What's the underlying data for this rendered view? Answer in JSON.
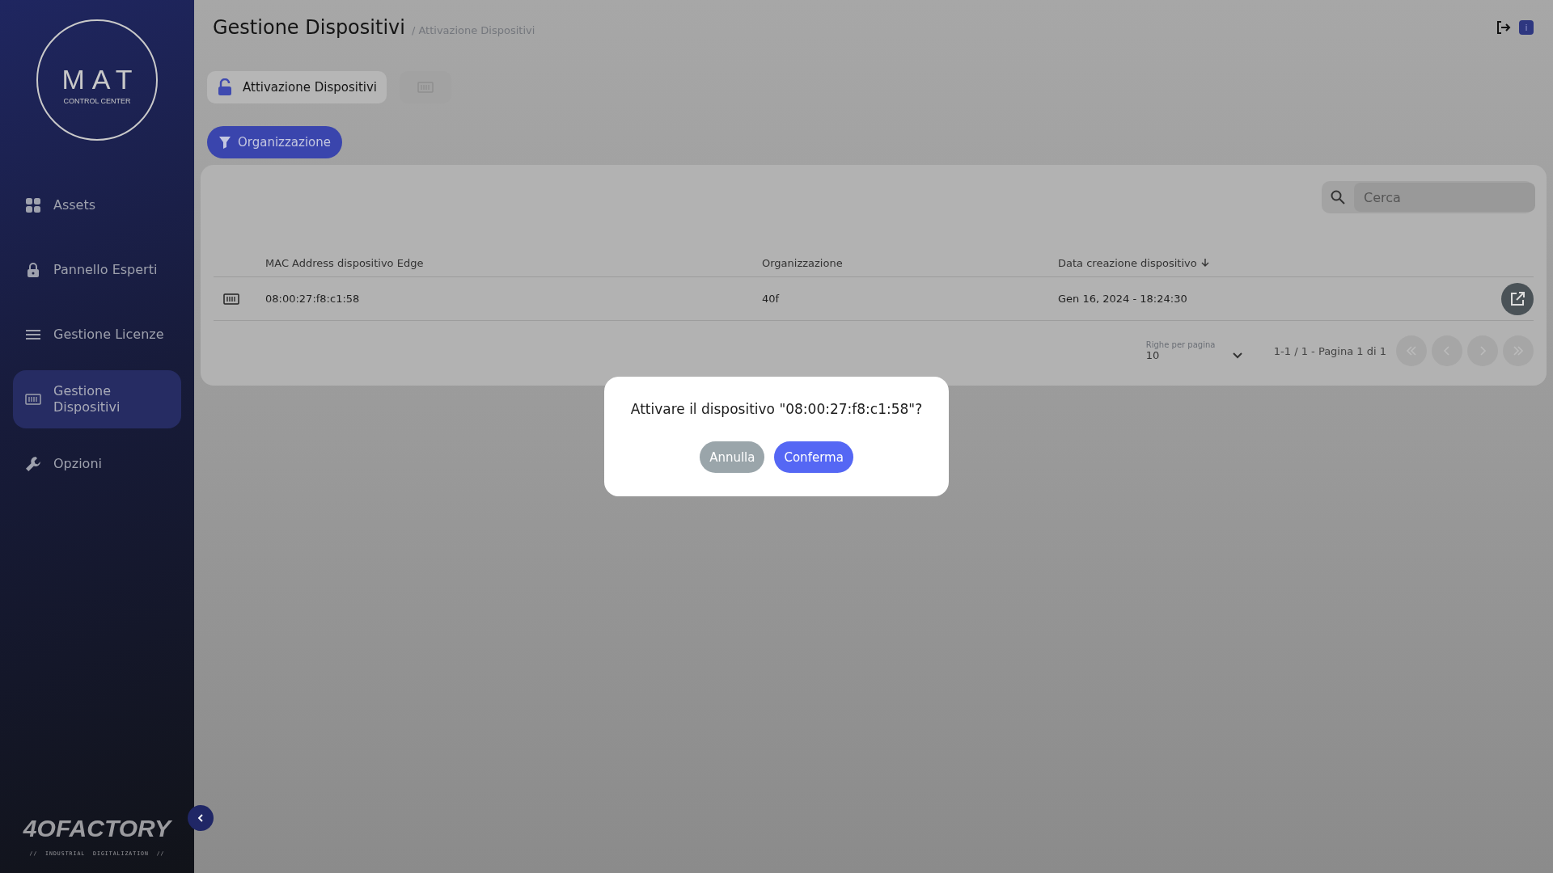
{
  "sidebar": {
    "logo": {
      "title": "MAT",
      "subtitle": "CONTROL CENTER"
    },
    "items": [
      {
        "label": "Assets",
        "selected": false
      },
      {
        "label": "Pannello Esperti",
        "selected": false
      },
      {
        "label": "Gestione Licenze",
        "selected": false
      },
      {
        "label": "Gestione Dispositivi",
        "selected": true
      },
      {
        "label": "Opzioni",
        "selected": false
      }
    ],
    "brand": {
      "name": "4OFACTORY",
      "tagline": "//  INDUSTRIAL  DIGITALIZATION  //"
    }
  },
  "header": {
    "title": "Gestione Dispositivi",
    "breadcrumb": "/ Attivazione Dispositivi",
    "info_badge": "i"
  },
  "tabs": [
    {
      "label": "Attivazione Dispositivi",
      "selected": true
    },
    {
      "selected": false
    }
  ],
  "filter_button": "Organizzazione",
  "search": {
    "placeholder": "Cerca"
  },
  "table": {
    "columns": [
      "MAC Address dispositivo Edge",
      "Organizzazione",
      "Data creazione dispositivo"
    ],
    "rows": [
      {
        "cells": [
          "08:00:27:f8:c1:58",
          "40f",
          "Gen 16, 2024 - 18:24:30"
        ]
      }
    ]
  },
  "pagination": {
    "rows_label": "Righe per pagina",
    "rows_value": "10",
    "range": "1-1 / 1 - Pagina 1 di 1",
    "buttons": [
      {
        "disabled": true
      },
      {
        "disabled": true
      },
      {
        "disabled": true
      },
      {
        "disabled": true
      }
    ]
  },
  "dialog": {
    "message": "Attivare il dispositivo \"08:00:27:f8:c1:58\"?",
    "buttons": [
      {
        "label": "Annulla",
        "kind": "cancel"
      },
      {
        "label": "Conferma",
        "kind": "confirm"
      }
    ]
  }
}
